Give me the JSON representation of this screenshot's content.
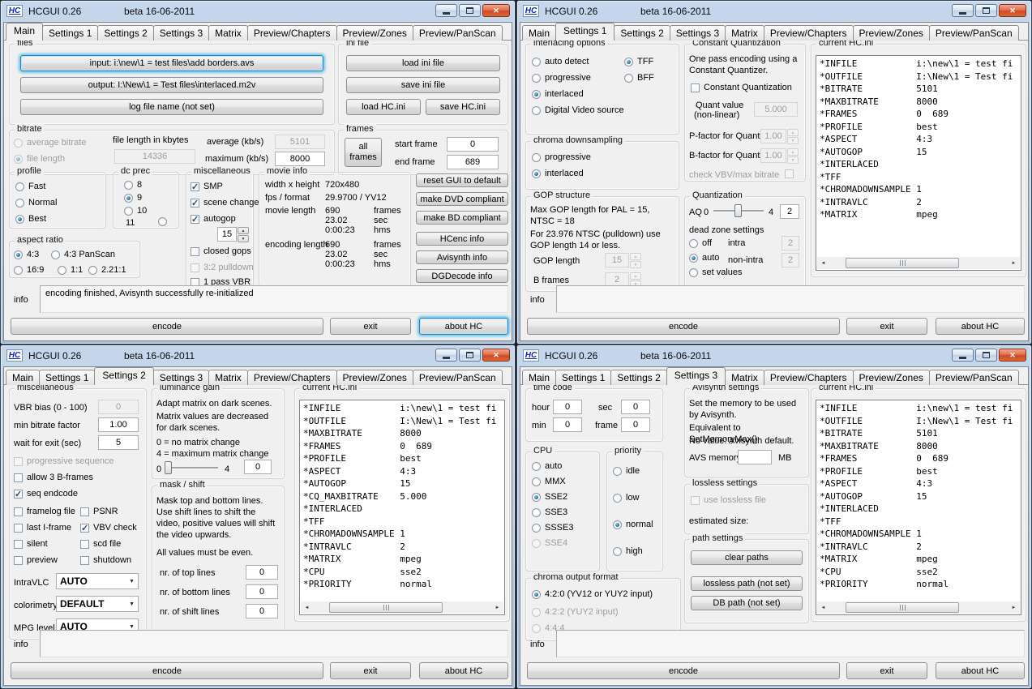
{
  "app": {
    "logo": "HC",
    "title": "HCGUI 0.26",
    "subtitle": "beta 16-06-2011",
    "tabs": [
      "Main",
      "Settings 1",
      "Settings 2",
      "Settings 3",
      "Matrix",
      "Preview/Chapters",
      "Preview/Zones",
      "Preview/PanScan"
    ],
    "info_label": "info",
    "encode_label": "encode",
    "exit_label": "exit",
    "about_label": "about HC",
    "icons": {
      "close": "✕",
      "combo_arrow": "▼",
      "spin_up": "▲",
      "spin_down": "▼",
      "scroll_left": "◄",
      "scroll_right": "►"
    }
  },
  "main": {
    "files": {
      "label": "files",
      "input_button": "input: i:\\new\\1 = test files\\add borders.avs",
      "output_button": "output: I:\\New\\1 = Test files\\interlaced.m2v",
      "log_button": "log file name (not set)"
    },
    "ini": {
      "label": "ini file",
      "load_ini": "load ini file",
      "save_ini": "save ini file",
      "load_hc": "load HC.ini",
      "save_hc": "save HC.ini"
    },
    "bitrate": {
      "label": "bitrate",
      "average_bitrate": "average bitrate",
      "file_length": "file length",
      "kbytes_label": "file length in kbytes",
      "kbytes": "14336",
      "average_label": "average (kb/s)",
      "average": "5101",
      "maximum_label": "maximum (kb/s)",
      "maximum": "8000"
    },
    "frames": {
      "label": "frames",
      "all_frames_1": "all",
      "all_frames_2": "frames",
      "start_label": "start frame",
      "start": "0",
      "end_label": "end frame",
      "end": "689"
    },
    "profile": {
      "label": "profile",
      "fast": "Fast",
      "normal": "Normal",
      "best": "Best"
    },
    "dcprec": {
      "label": "dc prec",
      "o8": "8",
      "o9": "9",
      "o10": "10",
      "o11": "11"
    },
    "misc": {
      "label": "miscellaneous",
      "smp": "SMP",
      "scene": "scene change",
      "autogop": "autogop",
      "autogop_value": "15",
      "closed": "closed gops",
      "pulldown": "3:2 pulldown",
      "vbr1": "1 pass VBR"
    },
    "movie": {
      "label": "movie info",
      "wh_label": "width x height",
      "wh": "720x480",
      "fps_label": "fps / format",
      "fps": "29.9700 / YV12",
      "len_label": "movie length",
      "len_frames": "690",
      "len_sec": "23.02",
      "len_hms": "0:00:23",
      "enc_label": "encoding length",
      "enc_frames": "690",
      "enc_sec": "23.02",
      "enc_hms": "0:00:23",
      "unit_frames": "frames",
      "unit_sec": "sec",
      "unit_hms": "hms"
    },
    "actions": {
      "reset": "reset GUI to default",
      "dvd": "make DVD compliant",
      "bd": "make BD compliant",
      "hcenc": "HCenc info",
      "avisynth": "Avisynth info",
      "dgdecode": "DGDecode info"
    },
    "aspect": {
      "label": "aspect ratio",
      "a43": "4:3",
      "a43p": "4:3 PanScan",
      "a169": "16:9",
      "a11": "1:1",
      "a221": "2.21:1"
    },
    "info_text": "encoding finished, Avisynth successfully re-initialized"
  },
  "s1": {
    "interlacing": {
      "label": "interlacing options",
      "auto": "auto detect",
      "progressive": "progressive",
      "interlaced": "interlaced",
      "dv": "Digital Video source",
      "tff": "TFF",
      "bff": "BFF"
    },
    "chroma": {
      "label": "chroma downsampling",
      "progressive": "progressive",
      "interlaced": "interlaced"
    },
    "gop": {
      "label": "GOP structure",
      "note1": "Max GOP length for PAL = 15, NTSC = 18",
      "note2": "For 23.976 NTSC (pulldown) use GOP length 14 or less.",
      "gop_label": "GOP length",
      "gop_value": "15",
      "b_label": "B frames",
      "b_value": "2"
    },
    "cq": {
      "label": "Constant Quantization",
      "note": "One pass encoding using a Constant Quantizer.",
      "check": "Constant Quantization",
      "quant_label1": "Quant value",
      "quant_label2": "(non-linear)",
      "quant_value": "5.000",
      "p_label": "P-factor for Quant",
      "p_value": "1.00",
      "b_label": "B-factor for Quant",
      "b_value": "1.00",
      "vbv": "check VBV/max bitrate"
    },
    "quant": {
      "label": "Quantization",
      "aq": "AQ",
      "min": "0",
      "max": "4",
      "value": "2",
      "dz_label": "dead zone settings",
      "off": "off",
      "auto": "auto",
      "set": "set values",
      "intra_label": "intra",
      "intra": "2",
      "nonintra_label": "non-intra",
      "nonintra": "2"
    },
    "ini_label": "current HC.ini",
    "ini": "*INFILE           i:\\new\\1 = test fi\n*OUTFILE          I:\\New\\1 = Test fi\n*BITRATE          5101\n*MAXBITRATE       8000\n*FRAMES           0  689\n*PROFILE          best\n*ASPECT           4:3\n*AUTOGOP          15\n*INTERLACED\n*TFF\n*CHROMADOWNSAMPLE 1\n*INTRAVLC         2\n*MATRIX           mpeg"
  },
  "s2": {
    "misc": {
      "label": "miscellaneous",
      "vbr_label": "VBR bias (0 - 100)",
      "vbr": "0",
      "minbit_label": "min bitrate factor",
      "minbit": "1.00",
      "wait_label": "wait for exit (sec)",
      "wait": "5",
      "prog_seq": "progressive sequence",
      "b3": "allow 3 B-frames",
      "seq": "seq endcode",
      "framelog": "framelog file",
      "psnr": "PSNR",
      "lastif": "last I-frame",
      "vbv": "VBV check",
      "silent": "silent",
      "scd": "scd file",
      "preview": "preview",
      "shutdown": "shutdown",
      "intravlc_label": "IntraVLC",
      "intravlc": "AUTO",
      "colorimetry_label": "colorimetry",
      "colorimetry": "DEFAULT",
      "mpg_label": "MPG level",
      "mpg": "AUTO"
    },
    "lum": {
      "label": "luminance gain",
      "note1": "Adapt matrix on dark scenes.",
      "note2": "Matrix values are decreased for dark scenes.",
      "note3": "0 = no matrix change",
      "note4": "4 = maximum matrix change",
      "min": "0",
      "max": "4",
      "value": "0"
    },
    "mask": {
      "label": "mask / shift",
      "note1": "Mask top and bottom lines. Use shift lines to shift the video, positive values will shift the video upwards.",
      "note2": "All values must be even.",
      "top_label": "nr. of top lines",
      "top": "0",
      "bottom_label": "nr. of bottom lines",
      "bottom": "0",
      "shift_label": "nr. of shift lines",
      "shift": "0"
    },
    "ini_label": "current HC.ini",
    "ini": "*INFILE           i:\\new\\1 = test fi\n*OUTFILE          I:\\New\\1 = Test fi\n*MAXBITRATE       8000\n*FRAMES           0  689\n*PROFILE          best\n*ASPECT           4:3\n*AUTOGOP          15\n*CQ_MAXBITRATE    5.000\n*INTERLACED\n*TFF\n*CHROMADOWNSAMPLE 1\n*INTRAVLC         2\n*MATRIX           mpeg\n*CPU              sse2\n*PRIORITY         normal"
  },
  "s3": {
    "timecode": {
      "label": "time code",
      "hour_label": "hour",
      "hour": "0",
      "min_label": "min",
      "min": "0",
      "sec_label": "sec",
      "sec": "0",
      "frame_label": "frame",
      "frame": "0"
    },
    "cpu": {
      "label": "CPU",
      "auto": "auto",
      "mmx": "MMX",
      "sse2": "SSE2",
      "sse3": "SSE3",
      "ssse3": "SSSE3",
      "sse4": "SSE4"
    },
    "priority": {
      "label": "priority",
      "idle": "idle",
      "low": "low",
      "normal": "normal",
      "high": "high"
    },
    "chromaout": {
      "label": "chroma output format",
      "o420": "4:2:0 (YV12 or YUY2 input)",
      "o422": "4:2:2 (YUY2 input)",
      "o444": "4:4:4"
    },
    "avisynth": {
      "label": "Avisynth settings",
      "note1": "Set the memory to be used by Avisynth.",
      "note2": "Equivalent to SetMemoryMax()",
      "note3": "No value: Avisynth default.",
      "mem_label": "AVS memory",
      "mem": "",
      "mb": "MB"
    },
    "lossless": {
      "label": "lossless settings",
      "use": "use lossless file",
      "estimated": "estimated size:"
    },
    "paths": {
      "label": "path settings",
      "clear": "clear paths",
      "lossless": "lossless path (not set)",
      "db": "DB path (not set)"
    },
    "ini_label": "current HC.ini",
    "ini": "*INFILE           i:\\new\\1 = test fi\n*OUTFILE          I:\\New\\1 = Test fi\n*BITRATE          5101\n*MAXBITRATE       8000\n*FRAMES           0  689\n*PROFILE          best\n*ASPECT           4:3\n*AUTOGOP          15\n*INTERLACED\n*TFF\n*CHROMADOWNSAMPLE 1\n*INTRAVLC         2\n*MATRIX           mpeg\n*CPU              sse2\n*PRIORITY         normal"
  }
}
